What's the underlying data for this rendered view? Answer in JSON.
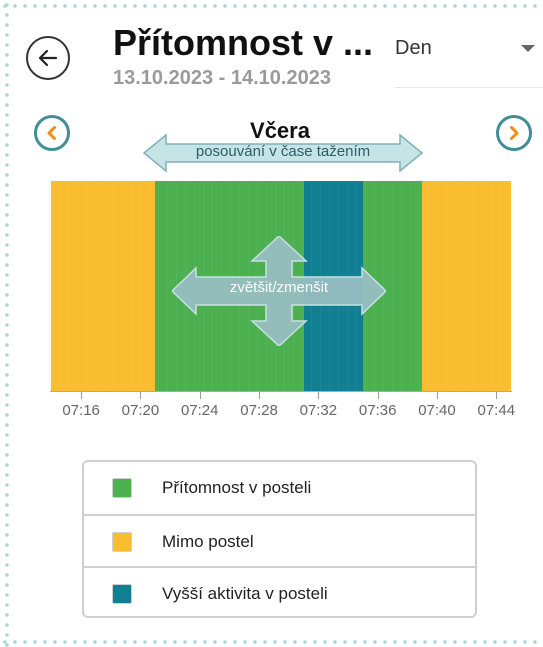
{
  "header": {
    "title": "Přítomnost v ...",
    "date_range": "13.10.2023 - 14.10.2023",
    "period": {
      "selected": "Den"
    }
  },
  "navigation": {
    "day_label": "Včera",
    "pan_hint": "posouvání v čase tažením",
    "zoom_hint": "zvětšit/zmenšit"
  },
  "colors": {
    "presence": "#4caf50",
    "out_of_bed": "#fbbd30",
    "high_activity": "#0f7f91",
    "nav_accent": "#3f8f95"
  },
  "chart_data": {
    "type": "bar",
    "x_ticks": [
      "07:16",
      "07:20",
      "07:24",
      "07:28",
      "07:32",
      "07:36",
      "07:40",
      "07:44"
    ],
    "segments": [
      {
        "state": "Mimo postel",
        "start": "07:14",
        "end": "07:21"
      },
      {
        "state": "Přítomnost v posteli",
        "start": "07:21",
        "end": "07:31"
      },
      {
        "state": "Vyšší aktivita v posteli",
        "start": "07:31",
        "end": "07:35"
      },
      {
        "state": "Přítomnost v posteli",
        "start": "07:35",
        "end": "07:39"
      },
      {
        "state": "Mimo postel",
        "start": "07:39",
        "end": "07:45"
      }
    ]
  },
  "legend": {
    "items": [
      {
        "label": "Přítomnost v posteli",
        "color": "#4caf50"
      },
      {
        "label": "Mimo postel",
        "color": "#fbbd30"
      },
      {
        "label": "Vyšší aktivita v posteli",
        "color": "#0f7f91"
      }
    ]
  }
}
